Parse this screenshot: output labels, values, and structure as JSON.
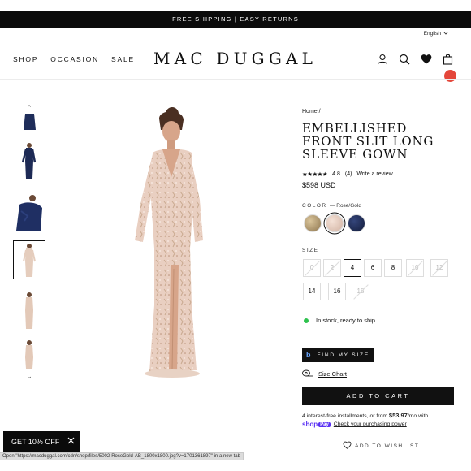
{
  "announcement": "FREE SHIPPING  |  EASY RETURNS",
  "language": "English",
  "nav": [
    "SHOP",
    "OCCASION",
    "SALE"
  ],
  "logo": "MAC DUGGAL",
  "breadcrumb": "Home /",
  "product": {
    "title": "EMBELLISHED FRONT SLIT LONG SLEEVE GOWN",
    "stars": "★★★★★",
    "rating": "4.8",
    "review_count": "(4)",
    "write_review": "Write a review",
    "price": "$598 USD"
  },
  "color": {
    "label": "COLOR",
    "selected": "— Rose/Gold",
    "swatches": [
      {
        "name": "Gold",
        "color": "#b49a6e"
      },
      {
        "name": "Rose/Gold",
        "color": "#e7cfc2"
      },
      {
        "name": "Navy",
        "color": "#1d2a52"
      }
    ]
  },
  "size": {
    "label": "SIZE",
    "options": [
      {
        "value": "0",
        "available": false
      },
      {
        "value": "2",
        "available": false
      },
      {
        "value": "4",
        "available": true,
        "selected": true
      },
      {
        "value": "6",
        "available": true
      },
      {
        "value": "8",
        "available": true
      },
      {
        "value": "10",
        "available": false
      },
      {
        "value": "12",
        "available": false
      },
      {
        "value": "14",
        "available": true
      },
      {
        "value": "16",
        "available": true
      },
      {
        "value": "18",
        "available": false
      }
    ]
  },
  "stock": "In stock, ready to ship",
  "find_my_size": "FIND MY SIZE",
  "size_chart": "Size Chart",
  "add_to_cart": "ADD TO CART",
  "installments": {
    "text": "4 interest-free installments, or from ",
    "amount": "$53.97",
    "suffix": "/mo with",
    "shop": "shop",
    "pay": "Pay",
    "link": "Check your purchasing power"
  },
  "wishlist": "ADD TO WISHLIST",
  "promo": "GET 10% OFF",
  "status_bar": "Open \"https://macduggal.com/cdn/shop/files/5002-RoseGold-AB_1800x1800.jpg?v=1701361897\" in a new tab",
  "colors": {
    "accent": "#111111",
    "stock_green": "#2ec24e",
    "cart_badge": "#e4463a",
    "shop_pay": "#5a31f4"
  }
}
